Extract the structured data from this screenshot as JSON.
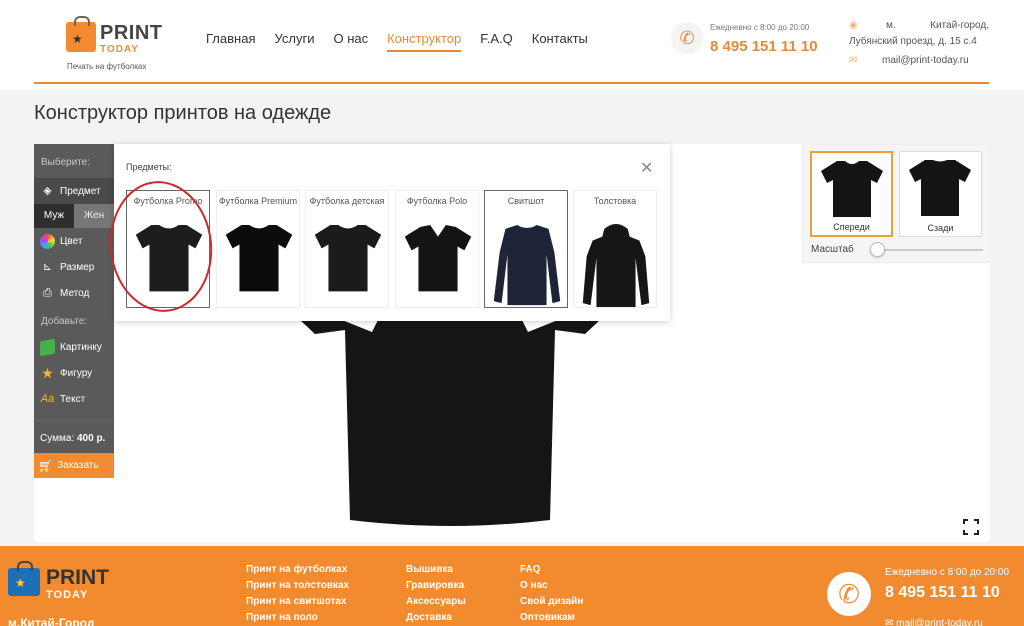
{
  "brand": {
    "print": "PRINT",
    "today": "TODAY",
    "tagline": "Печать на футболках"
  },
  "nav": {
    "items": [
      {
        "label": "Главная",
        "active": false
      },
      {
        "label": "Услуги",
        "active": false
      },
      {
        "label": "О нас",
        "active": false
      },
      {
        "label": "Конструктор",
        "active": true
      },
      {
        "label": "F.A.Q",
        "active": false
      },
      {
        "label": "Контакты",
        "active": false
      }
    ]
  },
  "contacts": {
    "hours": "Ежедневно с 8:00 до 20:00",
    "phone": "8 495 151 11 10",
    "address_line1": "м. Китай-город,",
    "address_line2": "Лубянский проезд, д. 15 с.4",
    "email": "mail@print-today.ru"
  },
  "page": {
    "title": "Конструктор принтов на одежде"
  },
  "sidebar": {
    "choose_label": "Выберите:",
    "subject_label": "Предмет",
    "gender_male": "Муж",
    "gender_female": "Жен",
    "color_label": "Цвет",
    "size_label": "Размер",
    "method_label": "Метод",
    "add_label": "Добавьте:",
    "picture_label": "Картинку",
    "shape_label": "Фигуру",
    "text_label": "Текст",
    "sum_label": "Сумма:",
    "sum_value": "400 р.",
    "order_label": "Заказать"
  },
  "popup": {
    "title": "Предметы:",
    "products": [
      {
        "name": "Футболка Promo",
        "type": "tshirt",
        "color": "#1d1d1d",
        "selected": true
      },
      {
        "name": "Футболка Premium",
        "type": "tshirt",
        "color": "#0c0c0c",
        "selected": false
      },
      {
        "name": "Футболка детская",
        "type": "tshirt",
        "color": "#1b1b1b",
        "selected": false
      },
      {
        "name": "Футболка Polo",
        "type": "polo",
        "color": "#141414",
        "selected": false
      },
      {
        "name": "Свитшот",
        "type": "sweatshirt",
        "color": "#1e2438",
        "selected": true
      },
      {
        "name": "Толстовка",
        "type": "hoodie",
        "color": "#161616",
        "selected": false
      }
    ]
  },
  "views": {
    "front_label": "Спереди",
    "back_label": "Сзади",
    "scale_label": "Масштаб",
    "scale_fraction": 0.05
  },
  "footer": {
    "metro": "м.Китай-Город",
    "col1": [
      "Принт на футболках",
      "Принт на толстовках",
      "Принт на свитшотах",
      "Принт на поло"
    ],
    "col2": [
      "Вышивка",
      "Гравировка",
      "Аксессуары",
      "Доставка"
    ],
    "col3": [
      "FAQ",
      "О нас",
      "Свой дизайн",
      "Оптовикам"
    ],
    "hours": "Ежедневно с 8:00 до 20:00",
    "phone": "8 495 151 11 10",
    "email": "mail@print-today.ru"
  },
  "colors": {
    "accent": "#f28b30",
    "sidebar": "#5a5a5a",
    "annotation": "#c92a2a"
  }
}
